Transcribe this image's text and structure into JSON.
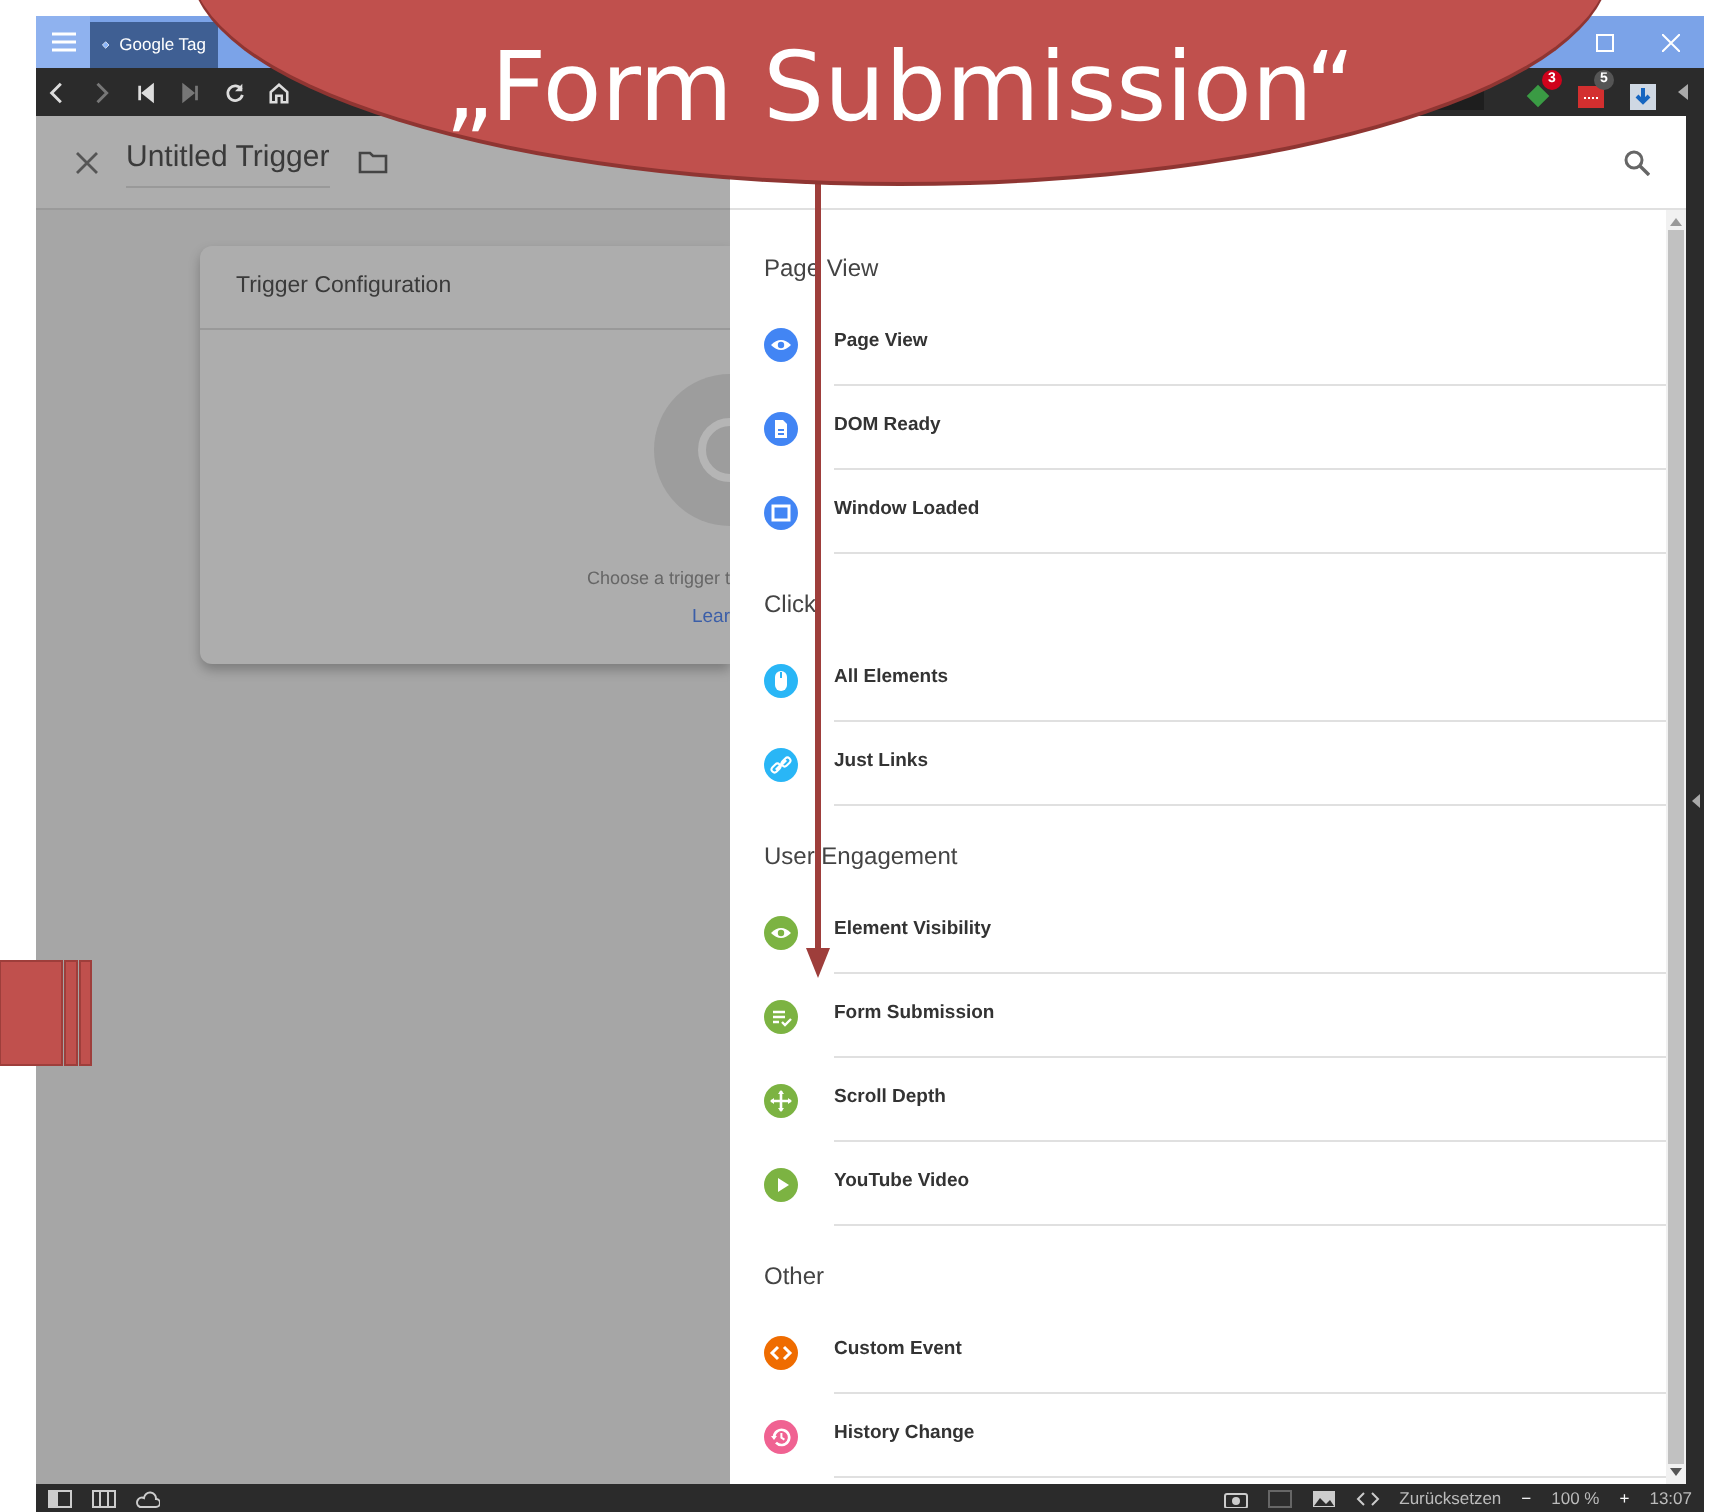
{
  "browser": {
    "tab_title": "Google Tag",
    "extension_badges": [
      "3",
      "5"
    ]
  },
  "trigger": {
    "title": "Untitled Trigger",
    "card_title": "Trigger Configuration",
    "hint": "Choose a trigger t",
    "link": "Lear"
  },
  "groups": [
    {
      "title": "Page View",
      "items": [
        {
          "label": "Page View",
          "kind": "eye",
          "color": "#4285f4"
        },
        {
          "label": "DOM Ready",
          "kind": "doc",
          "color": "#4285f4"
        },
        {
          "label": "Window Loaded",
          "kind": "window",
          "color": "#4285f4"
        }
      ]
    },
    {
      "title": "Click",
      "items": [
        {
          "label": "All Elements",
          "kind": "mouse",
          "color": "#29b6f6"
        },
        {
          "label": "Just Links",
          "kind": "link",
          "color": "#29b6f6"
        }
      ]
    },
    {
      "title": "User Engagement",
      "items": [
        {
          "label": "Element Visibility",
          "kind": "eye",
          "color": "#7cb342"
        },
        {
          "label": "Form Submission",
          "kind": "form",
          "color": "#7cb342"
        },
        {
          "label": "Scroll Depth",
          "kind": "move",
          "color": "#7cb342"
        },
        {
          "label": "YouTube Video",
          "kind": "play",
          "color": "#7cb342"
        }
      ]
    },
    {
      "title": "Other",
      "items": [
        {
          "label": "Custom Event",
          "kind": "code",
          "color": "#ef6c00"
        },
        {
          "label": "History Change",
          "kind": "history",
          "color": "#f06292"
        }
      ]
    }
  ],
  "status_bar": {
    "reset": "Zurücksetzen",
    "zoom_out": "−",
    "zoom": "100 %",
    "zoom_in": "+",
    "time": "13:07"
  },
  "callout": {
    "text": "„Form Submission“"
  }
}
